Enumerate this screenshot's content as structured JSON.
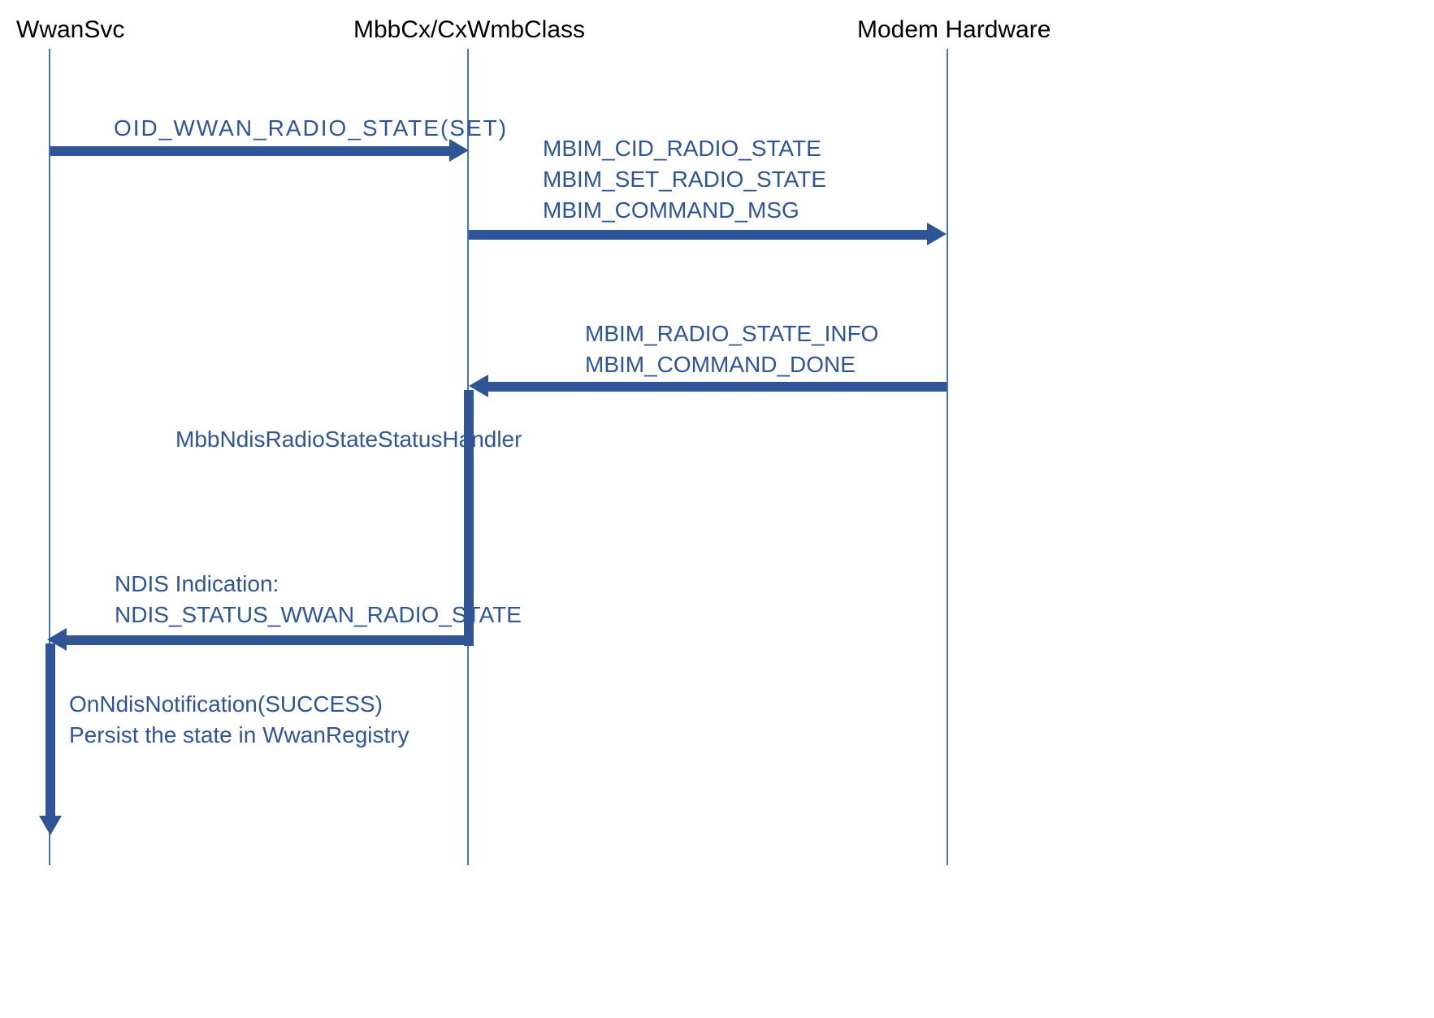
{
  "participants": {
    "wwansvc": "WwanSvc",
    "mbbcx": "MbbCx/CxWmbClass",
    "modem": "Modem Hardware"
  },
  "messages": {
    "oid_set": "OID_WWAN_RADIO_STATE(SET)",
    "mbim_cmd_line1": "MBIM_CID_RADIO_STATE",
    "mbim_cmd_line2": "MBIM_SET_RADIO_STATE",
    "mbim_cmd_line3": "MBIM_COMMAND_MSG",
    "mbim_resp_line1": "MBIM_RADIO_STATE_INFO",
    "mbim_resp_line2": "MBIM_COMMAND_DONE",
    "handler": "MbbNdisRadioStateStatusHandler",
    "ndis_ind_line1": "NDIS Indication:",
    "ndis_ind_line2": "NDIS_STATUS_WWAN_RADIO_STATE",
    "notif_line1": "OnNdisNotification(SUCCESS)",
    "notif_line2": "Persist the state in WwanRegistry"
  }
}
